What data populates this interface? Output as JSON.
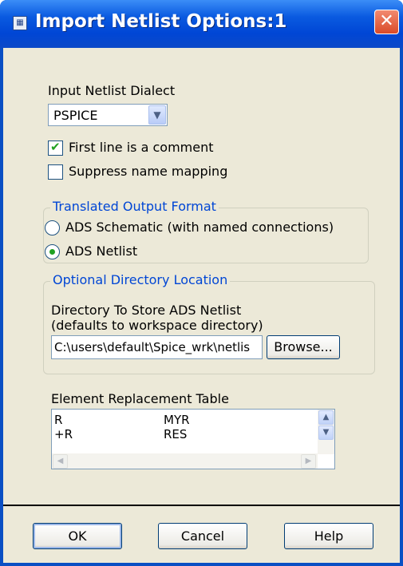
{
  "window": {
    "title": "Import Netlist Options:1",
    "close": "✕"
  },
  "dialect": {
    "label": "Input Netlist Dialect",
    "value": "PSPICE"
  },
  "options": {
    "first_line_comment": {
      "label": "First line is a comment",
      "checked": true
    },
    "suppress_mapping": {
      "label": "Suppress name mapping",
      "checked": false
    }
  },
  "output_format": {
    "title": "Translated Output Format",
    "schematic": "ADS Schematic (with named connections)",
    "netlist": "ADS Netlist",
    "selected": "ADS Netlist"
  },
  "directory": {
    "title": "Optional Directory Location",
    "label_line1": "Directory To Store ADS Netlist",
    "label_line2": "(defaults to workspace directory)",
    "path": "C:\\users\\default\\Spice_wrk\\netlis",
    "browse": "Browse..."
  },
  "replacement_table": {
    "label": "Element Replacement Table",
    "rows": [
      [
        "R",
        "MYR"
      ],
      [
        "+R",
        "RES"
      ]
    ]
  },
  "buttons": {
    "ok": "OK",
    "cancel": "Cancel",
    "help": "Help"
  }
}
